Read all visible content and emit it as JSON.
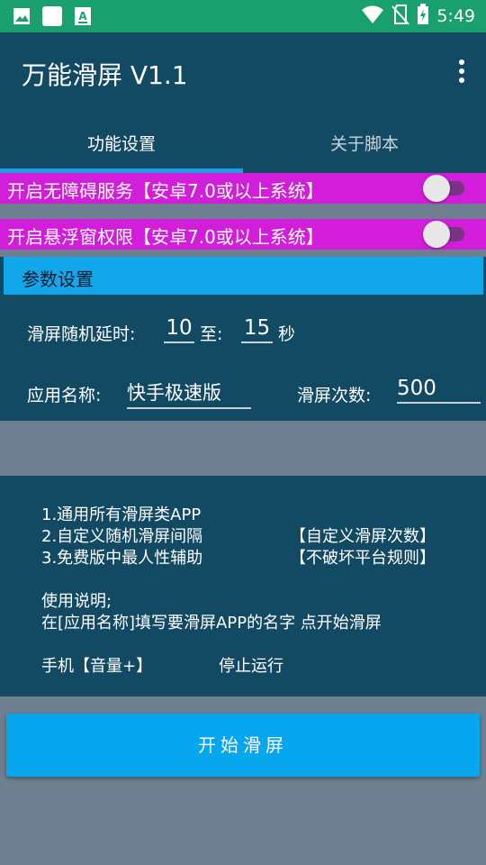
{
  "status_bar": {
    "time": "5:49",
    "left_icons": [
      "image-icon",
      "blank-app-icon",
      "font-download-icon"
    ],
    "right_icons": [
      "wifi-icon",
      "no-sim-icon",
      "battery-charging-icon"
    ],
    "color": "#1aa06e"
  },
  "app_bar": {
    "title": "万能滑屏 V1.1",
    "menu_icon": "more-vert-icon",
    "color": "#134a63"
  },
  "tabs": [
    {
      "label": "功能设置",
      "active": true
    },
    {
      "label": "关于脚本",
      "active": false
    }
  ],
  "toggles": [
    {
      "label": "开启无障碍服务【安卓7.0或以上系统】",
      "on": false
    },
    {
      "label": "开启悬浮窗权限【安卓7.0或以上系统】",
      "on": false
    }
  ],
  "param_header": "参数设置",
  "params": {
    "delay_label": "滑屏随机延时:",
    "delay_min": "10",
    "to_label": "至:",
    "delay_max": "15",
    "unit": "秒",
    "app_name_label": "应用名称:",
    "app_name": "快手极速版",
    "count_label": "滑屏次数:",
    "count": "500"
  },
  "info": {
    "line1": "1.通用所有滑屏类APP",
    "line2": "2.自定义随机滑屏间隔",
    "line2_right": "【自定义滑屏次数】",
    "line3": "3.免费版中最人性辅助",
    "line3_right": "【不破坏平台规则】",
    "usage_title": "使用说明;",
    "usage_text": "在[应用名称]填写要滑屏APP的名字 点开始滑屏",
    "stop_key": "手机【音量+】",
    "stop_text": "停止运行"
  },
  "start_button": "开始滑屏",
  "colors": {
    "accent": "#06a7ef",
    "toggle_bg": "#d21edb",
    "panel": "#134a63",
    "page_bg": "#6e7f8f"
  }
}
